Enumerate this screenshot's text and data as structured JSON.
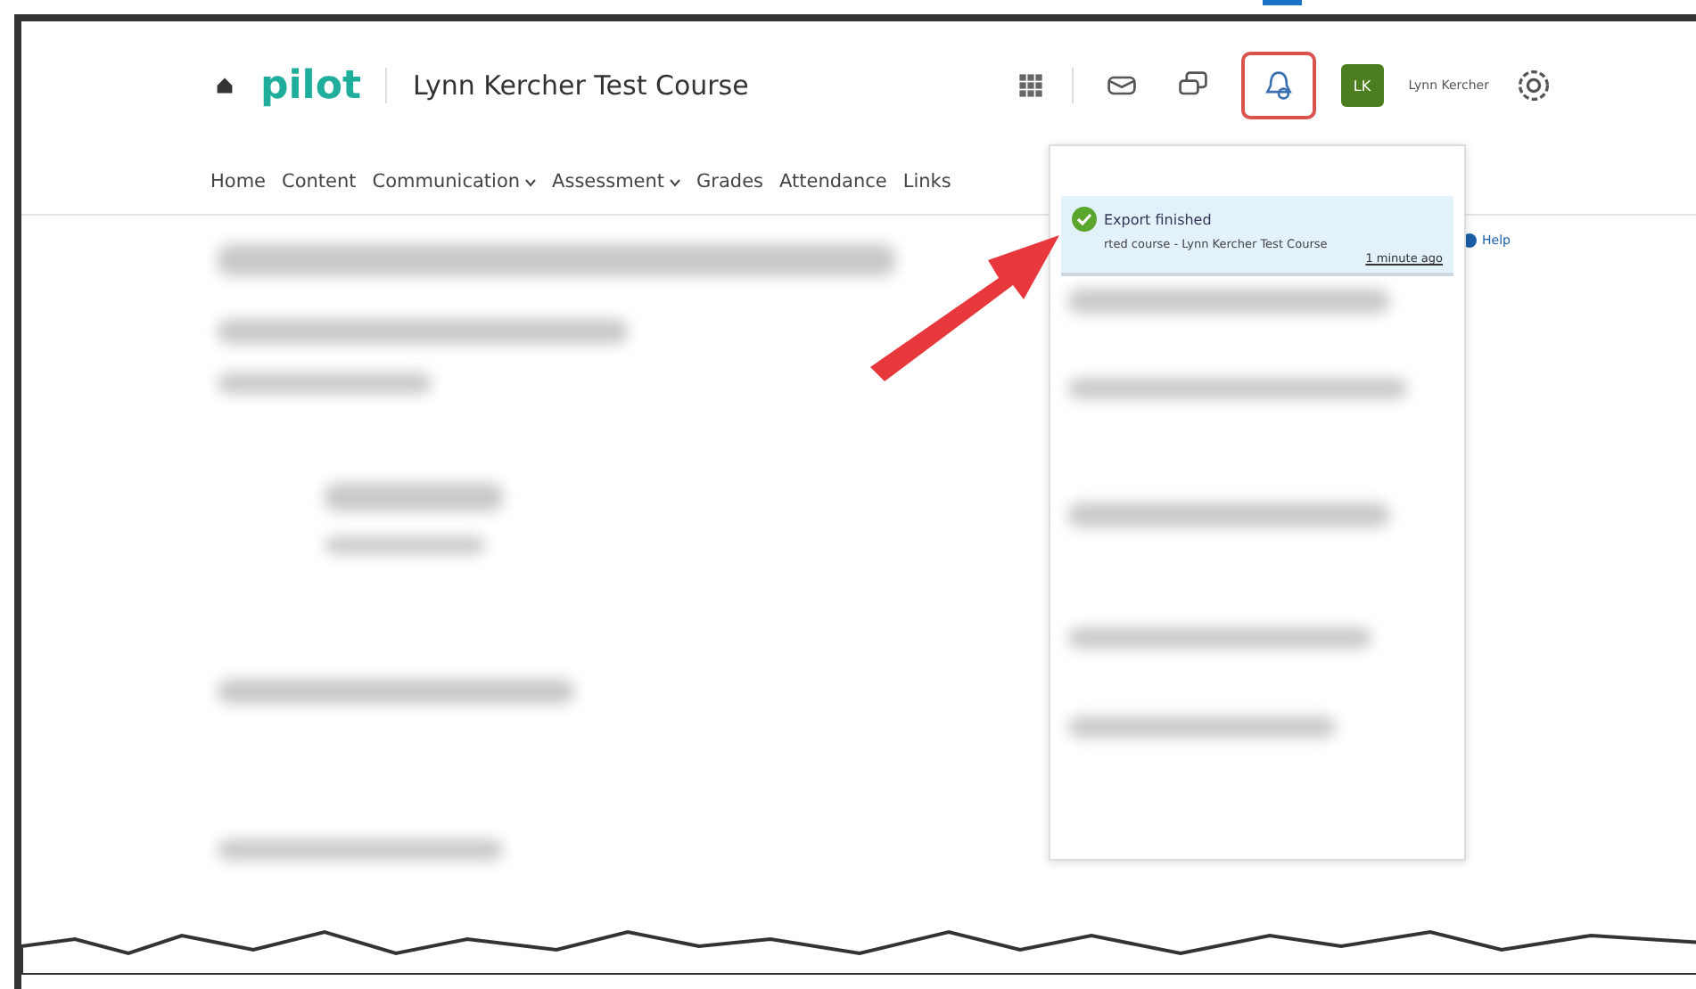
{
  "header": {
    "logo": "pilot",
    "course_title": "Lynn Kercher Test Course",
    "user": {
      "initials": "LK",
      "name": "Lynn Kercher"
    },
    "icons": [
      {
        "kind": "mail",
        "selected": false
      },
      {
        "kind": "chat",
        "selected": false
      },
      {
        "kind": "bell",
        "selected": true
      }
    ]
  },
  "nav": [
    {
      "label": "Home",
      "dropdown": false
    },
    {
      "label": "Content",
      "dropdown": false
    },
    {
      "label": "Communication",
      "dropdown": true
    },
    {
      "label": "Assessment",
      "dropdown": true
    },
    {
      "label": "Grades",
      "dropdown": false
    },
    {
      "label": "Attendance",
      "dropdown": false
    },
    {
      "label": "Links",
      "dropdown": false
    }
  ],
  "help": "Help",
  "notifications": [
    {
      "title": "Export finished",
      "detail": "rted course - Lynn Kercher Test Course",
      "time": "1 minute ago",
      "unread": true
    }
  ]
}
